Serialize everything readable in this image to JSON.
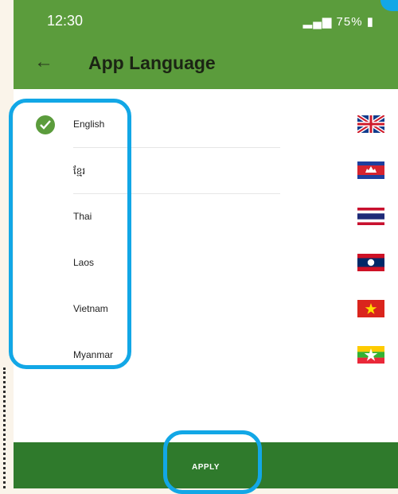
{
  "status_bar": {
    "time": "12:30",
    "battery": "75%"
  },
  "app_bar": {
    "title": "App Language",
    "back_icon": "arrow-left-icon"
  },
  "languages": [
    {
      "label": "English",
      "selected": true
    },
    {
      "label": "ខ្មែរ",
      "selected": false
    },
    {
      "label": "Thai",
      "selected": false
    },
    {
      "label": "Laos",
      "selected": false
    },
    {
      "label": "Vietnam",
      "selected": false
    },
    {
      "label": "Myanmar",
      "selected": false
    }
  ],
  "apply_button": {
    "label": "APPLY"
  },
  "colors": {
    "primary": "#5b9c3c",
    "apply_bg": "#2f7a2c",
    "highlight": "#12a7e6"
  }
}
